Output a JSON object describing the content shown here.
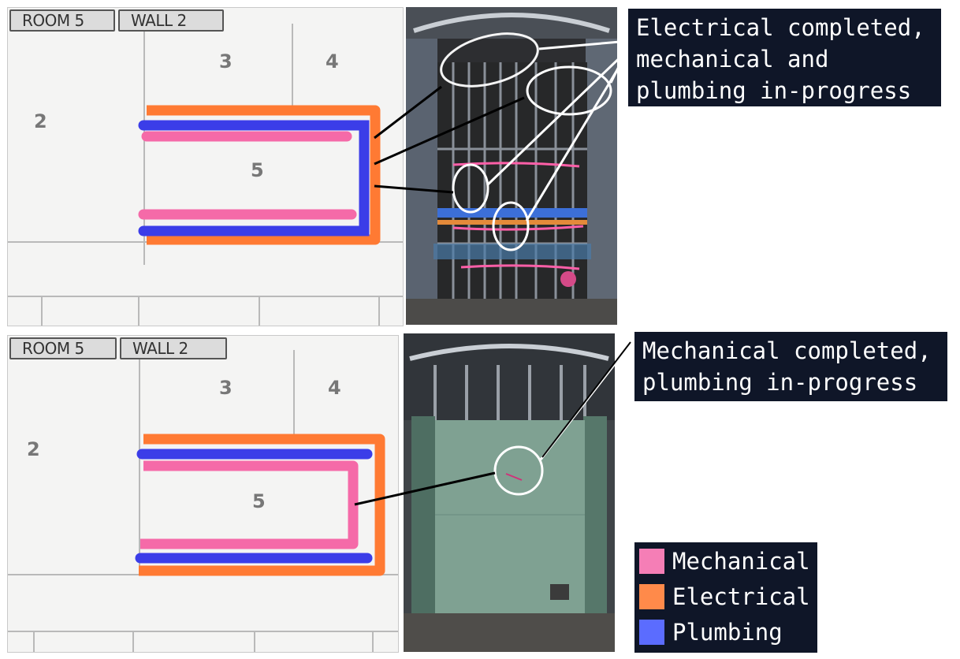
{
  "top_panel": {
    "sketch": {
      "room_tag": "ROOM 5",
      "wall_tag": "WALL 2",
      "room_numbers": [
        "2",
        "3",
        "4",
        "5"
      ]
    },
    "callout": "Electrical completed,\nmechanical and\nplumbing in-progress"
  },
  "bottom_panel": {
    "sketch": {
      "room_tag": "ROOM 5",
      "wall_tag": "WALL 2",
      "room_numbers": [
        "2",
        "3",
        "4",
        "5"
      ]
    },
    "callout": "Mechanical completed,\nplumbing in-progress"
  },
  "legend": {
    "items": [
      {
        "label": "Mechanical",
        "color": "#f57eb6"
      },
      {
        "label": "Electrical",
        "color": "#ff8a4a"
      },
      {
        "label": "Plumbing",
        "color": "#5b6cff"
      }
    ]
  },
  "colors": {
    "mechanical": "#f56aa8",
    "electrical": "#ff7a33",
    "plumbing": "#3b3de8",
    "callout_bg": "#0f1628"
  }
}
